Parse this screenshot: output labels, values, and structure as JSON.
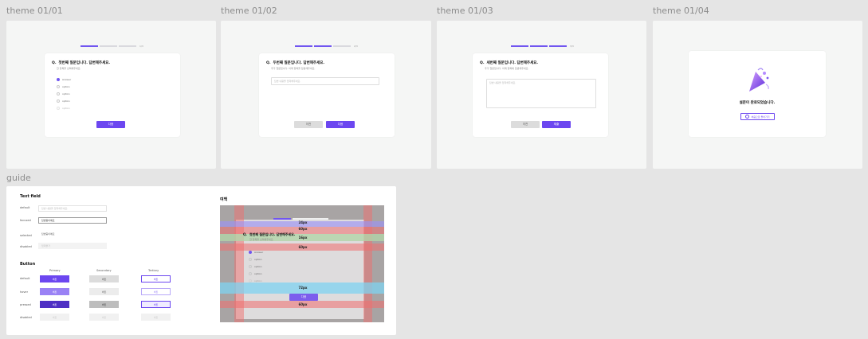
{
  "frames": {
    "t1": {
      "label": "theme 01/01"
    },
    "t2": {
      "label": "theme 01/02"
    },
    "t3": {
      "label": "theme 01/03"
    },
    "t4": {
      "label": "theme 01/04"
    },
    "guide": {
      "label": "guide"
    }
  },
  "screen1": {
    "progress_text": "1/3",
    "question_mark": "Q.",
    "question": "첫번째 질문입니다. 답변해주세요.",
    "sub": "한 항목을 선택해주세요.",
    "options": [
      "Answer",
      "option",
      "option",
      "option",
      "option"
    ],
    "next_label": "다음"
  },
  "screen2": {
    "progress_text": "2/3",
    "question_mark": "Q.",
    "question": "두번째 질문입니다. 답변해주세요.",
    "sub": "추가 질문입니다. 아래 항목을 답변해주세요.",
    "placeholder": "답변 내용을 입력해주세요.",
    "prev_label": "이전",
    "next_label": "다음"
  },
  "screen3": {
    "progress_text": "3/3",
    "question_mark": "Q.",
    "question": "세번째 질문입니다. 답변해주세요.",
    "sub": "추가 질문입니다. 아래 항목에 답변해주세요.",
    "placeholder": "답변 내용을 입력해주세요.",
    "prev_label": "이전",
    "submit_label": "제출"
  },
  "screen4": {
    "title": "설문이 완료되었습니다.",
    "home_label": "처음으로 돌아가기"
  },
  "guide": {
    "textfield": {
      "title": "Text field",
      "rows": [
        {
          "state": "default",
          "value": "답변 내용을 입력해주세요."
        },
        {
          "state": "focused",
          "value": "답변중이에요"
        },
        {
          "state": "selected",
          "value": "답변중이에요"
        },
        {
          "state": "disabled",
          "value": "입력불가"
        }
      ]
    },
    "button": {
      "title": "Button",
      "cols": [
        "Primary",
        "Secondary",
        "Tertiary"
      ],
      "rows": [
        "default",
        "hover",
        "pressed",
        "disabled"
      ],
      "cell_label": "버튼"
    },
    "spacing": {
      "title": "여백",
      "labels": [
        "24px",
        "60px",
        "16px",
        "60px",
        "72px",
        "60px"
      ],
      "question_mark": "Q.",
      "question": "첫번째 질문입니다. 답변해주세요.",
      "sub": "한 항목을 선택해주세요.",
      "options": [
        "Answer",
        "option",
        "option",
        "option",
        "option"
      ],
      "next_label": "다음"
    }
  },
  "colors": {
    "accent": "#6c47f0",
    "accent_light": "#9a82f5",
    "accent_dark": "#4e2fc4",
    "canvas": "#e5e5e5",
    "frame": "#f5f6f5",
    "overlay_red": "#f07070",
    "overlay_blue": "#7fd3f0",
    "overlay_green": "#9fdf90",
    "overlay_purple": "#9b92f5"
  }
}
